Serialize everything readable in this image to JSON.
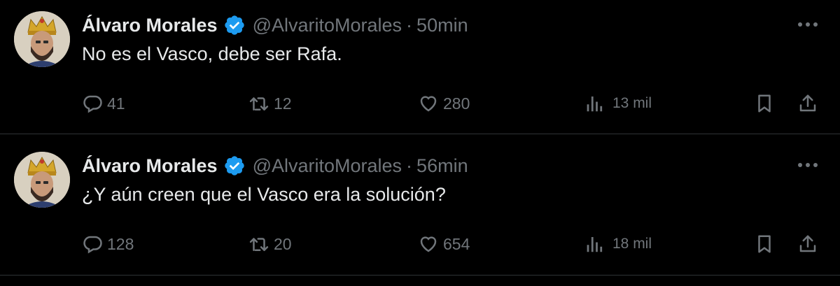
{
  "tweets": [
    {
      "author_name": "Álvaro Morales",
      "handle": "@AlvaritoMorales",
      "separator": "·",
      "time": "50min",
      "text": "No es el Vasco, debe ser Rafa.",
      "replies": "41",
      "retweets": "12",
      "likes": "280",
      "views": "13 mil",
      "more_icon": "more-dots-icon",
      "verified_icon": "verified-badge-icon"
    },
    {
      "author_name": "Álvaro Morales",
      "handle": "@AlvaritoMorales",
      "separator": "·",
      "time": "56min",
      "text": "¿Y aún creen que el Vasco era la solución?",
      "replies": "128",
      "retweets": "20",
      "likes": "654",
      "views": "18 mil",
      "more_icon": "more-dots-icon",
      "verified_icon": "verified-badge-icon"
    }
  ],
  "colors": {
    "background": "#000000",
    "text_primary": "#e7e9ea",
    "text_secondary": "#71767b",
    "verified": "#1d9bf0",
    "divider": "#2f3336"
  }
}
